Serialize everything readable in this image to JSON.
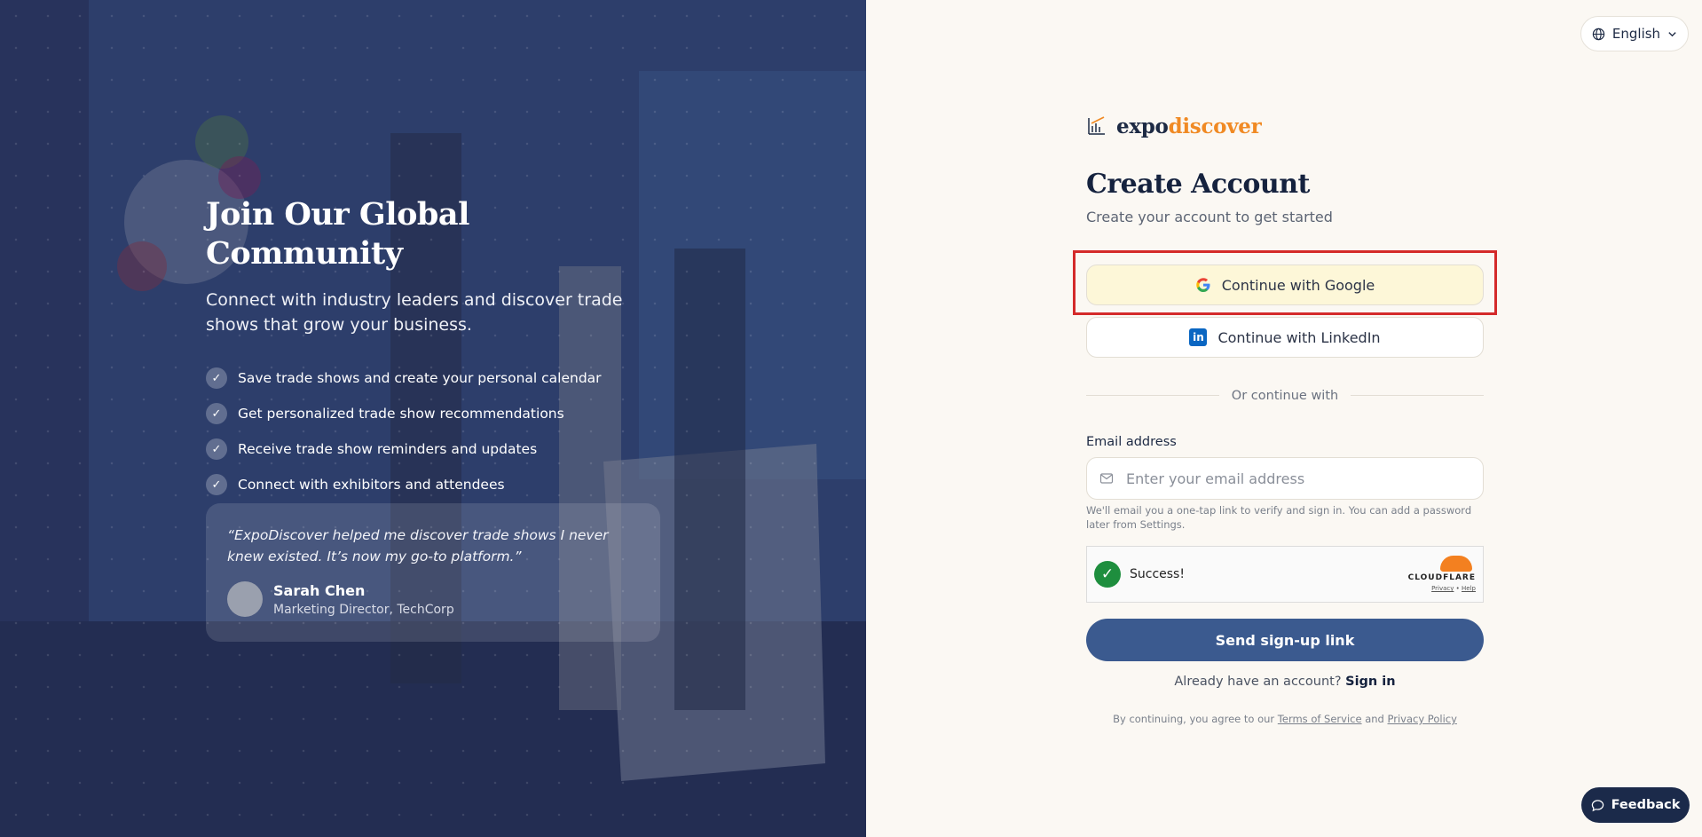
{
  "hero": {
    "title": "Join Our Global Community",
    "subtitle": "Connect with industry leaders and discover trade shows that grow your business.",
    "features": [
      "Save trade shows and create your personal calendar",
      "Get personalized trade show recommendations",
      "Receive trade show reminders and updates",
      "Connect with exhibitors and attendees"
    ],
    "testimonial": {
      "quote": "“ExpoDiscover helped me discover trade shows I never knew existed. It’s now my go-to platform.”",
      "name": "Sarah Chen",
      "role": "Marketing Director, TechCorp"
    }
  },
  "language": {
    "selected": "English"
  },
  "brand": {
    "part1": "expo",
    "part2": "discover",
    "accent_color": "#f08a24",
    "primary_color": "#3b5a8f"
  },
  "form": {
    "title": "Create Account",
    "subtitle": "Create your account to get started",
    "google_label": "Continue with Google",
    "linkedin_label": "Continue with LinkedIn",
    "divider_text": "Or continue with",
    "email_label": "Email address",
    "email_placeholder": "Enter your email address",
    "email_value": "",
    "hint": "We'll email you a one-tap link to verify and sign in. You can add a password later from Settings.",
    "captcha": {
      "status": "Success!",
      "provider": "CLOUDFLARE",
      "privacy": "Privacy",
      "help": "Help"
    },
    "submit_label": "Send sign-up link",
    "already_text": "Already have an account?",
    "sign_in_label": "Sign in",
    "terms_prefix": "By continuing, you agree to our",
    "terms_link": "Terms of Service",
    "terms_and": "and",
    "privacy_link": "Privacy Policy"
  },
  "feedback": {
    "label": "Feedback"
  }
}
